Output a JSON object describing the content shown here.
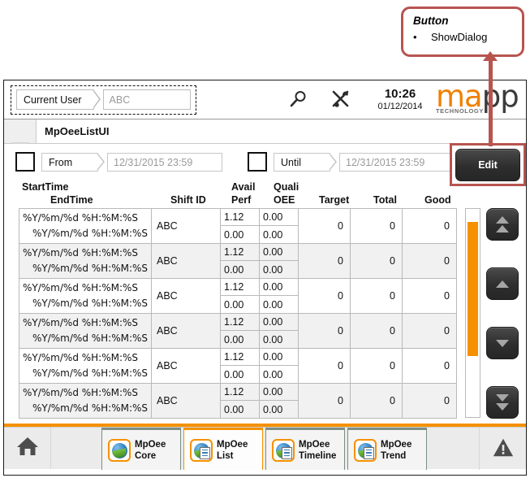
{
  "callout": {
    "title": "Button",
    "bullet_symbol": "•",
    "item": "ShowDialog",
    "border_color": "#b85450"
  },
  "header": {
    "user_label": "Current User",
    "user_value": "ABC",
    "search_icon": "search-icon",
    "tools_icon": "tools-icon",
    "time": "10:26",
    "date": "01/12/2014",
    "logo_part1": "ma",
    "logo_part2": "pp",
    "logo_sub": "TECHNOLOGY",
    "logo_accent": "#f08000"
  },
  "title_bar": {
    "title": "MpOeeListUI"
  },
  "filters": {
    "from_label": "From",
    "from_value": "12/31/2015 23:59",
    "until_label": "Until",
    "until_value": "12/31/2015 23:59",
    "edit_label": "Edit"
  },
  "table": {
    "headers": {
      "start_time": "StartTime",
      "end_time": "EndTime",
      "shift_id": "Shift ID",
      "avail": "Avail",
      "perf": "Perf",
      "quali": "Quali",
      "oee": "OEE",
      "target": "Target",
      "total": "Total",
      "good": "Good"
    },
    "rows": [
      {
        "start": "%Y/%m/%d %H:%M:%S",
        "end": "%Y/%m/%d %H:%M:%S",
        "shift": "ABC",
        "avail": "1.12",
        "perf": "0.00",
        "quali": "0.00",
        "oee": "0.00",
        "target": "0",
        "total": "0",
        "good": "0"
      },
      {
        "start": "%Y/%m/%d %H:%M:%S",
        "end": "%Y/%m/%d %H:%M:%S",
        "shift": "ABC",
        "avail": "1.12",
        "perf": "0.00",
        "quali": "0.00",
        "oee": "0.00",
        "target": "0",
        "total": "0",
        "good": "0"
      },
      {
        "start": "%Y/%m/%d %H:%M:%S",
        "end": "%Y/%m/%d %H:%M:%S",
        "shift": "ABC",
        "avail": "1.12",
        "perf": "0.00",
        "quali": "0.00",
        "oee": "0.00",
        "target": "0",
        "total": "0",
        "good": "0"
      },
      {
        "start": "%Y/%m/%d %H:%M:%S",
        "end": "%Y/%m/%d %H:%M:%S",
        "shift": "ABC",
        "avail": "1.12",
        "perf": "0.00",
        "quali": "0.00",
        "oee": "0.00",
        "target": "0",
        "total": "0",
        "good": "0"
      },
      {
        "start": "%Y/%m/%d %H:%M:%S",
        "end": "%Y/%m/%d %H:%M:%S",
        "shift": "ABC",
        "avail": "1.12",
        "perf": "0.00",
        "quali": "0.00",
        "oee": "0.00",
        "target": "0",
        "total": "0",
        "good": "0"
      },
      {
        "start": "%Y/%m/%d %H:%M:%S",
        "end": "%Y/%m/%d %H:%M:%S",
        "shift": "ABC",
        "avail": "1.12",
        "perf": "0.00",
        "quali": "0.00",
        "oee": "0.00",
        "target": "0",
        "total": "0",
        "good": "0"
      }
    ]
  },
  "scroll": {
    "thumb_color": "#f59100"
  },
  "nav_buttons": [
    {
      "icon": "double-up-icon"
    },
    {
      "icon": "up-icon"
    },
    {
      "icon": "down-icon"
    },
    {
      "icon": "double-down-icon"
    }
  ],
  "bottom_nav": {
    "home_icon": "home-icon",
    "warning_icon": "warning-icon",
    "accent": "#f59100",
    "tabs": [
      {
        "line1": "MpOee",
        "line2": "Core",
        "icon": "mpoee-core-icon",
        "active": false
      },
      {
        "line1": "MpOee",
        "line2": "List",
        "icon": "mpoee-list-icon",
        "active": true
      },
      {
        "line1": "MpOee",
        "line2": "Timeline",
        "icon": "mpoee-timeline-icon",
        "active": false
      },
      {
        "line1": "MpOee",
        "line2": "Trend",
        "icon": "mpoee-trend-icon",
        "active": false
      }
    ]
  }
}
